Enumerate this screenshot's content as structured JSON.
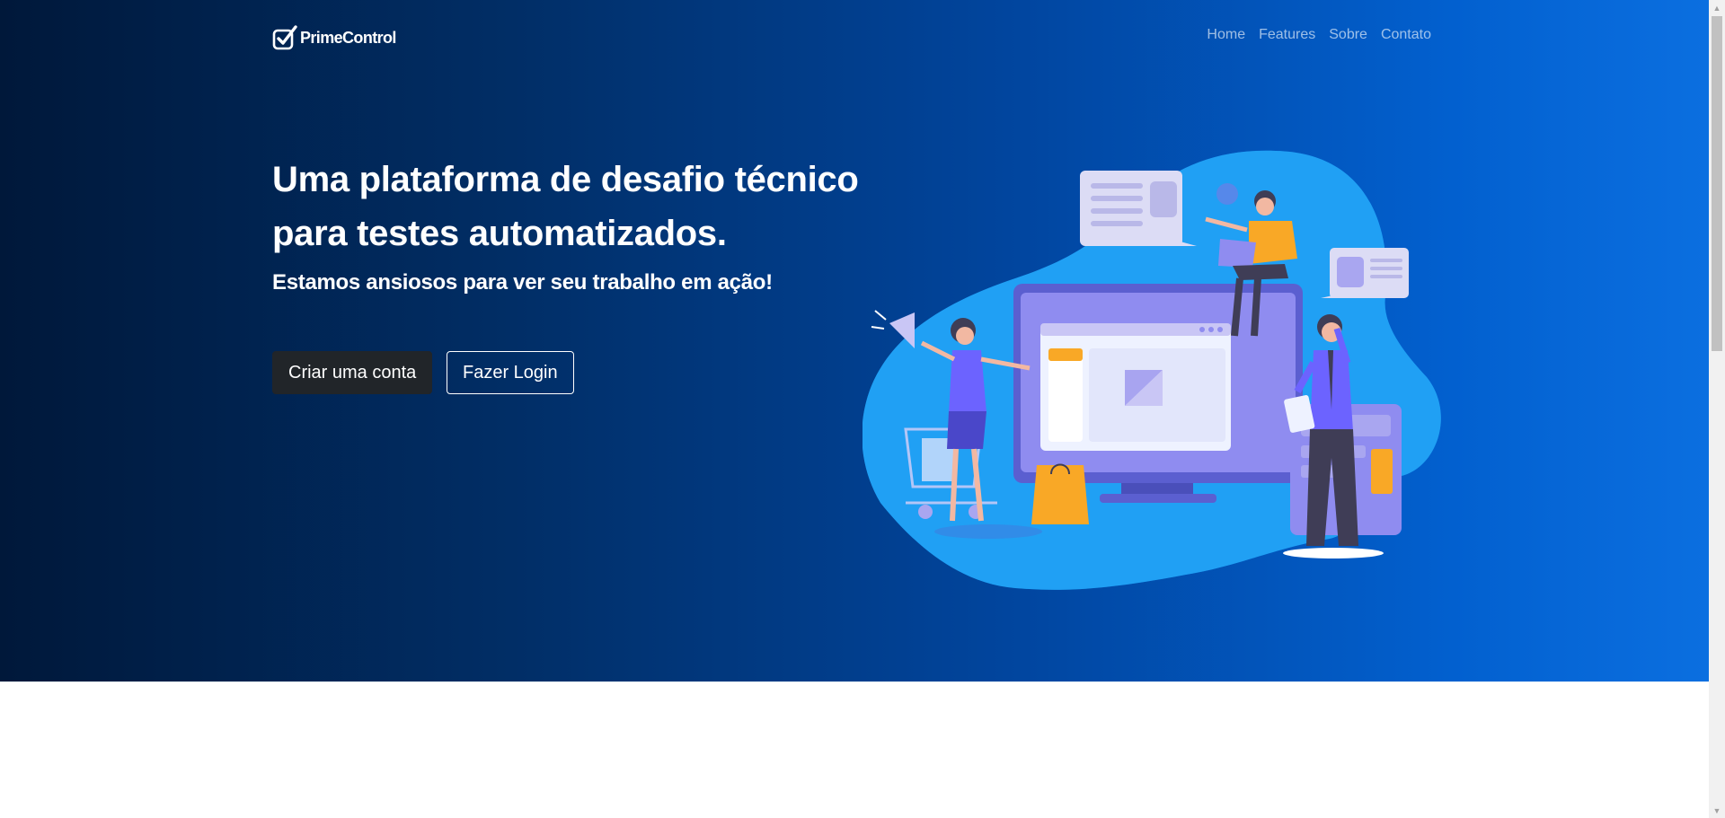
{
  "brand": {
    "name": "PrimeControl",
    "icon": "checkbox-logo-icon"
  },
  "nav": {
    "links": [
      "Home",
      "Features",
      "Sobre",
      "Contato"
    ]
  },
  "hero": {
    "headline": "Uma plataforma de desafio técnico para testes automatizados.",
    "subheadline": "Estamos ansiosos para ver seu trabalho em ação!",
    "primary_button": "Criar uma conta",
    "secondary_button": "Fazer Login",
    "illustration": "team-with-computer-illustration"
  },
  "colors": {
    "hero_gradient_start": "#00183a",
    "hero_gradient_end": "#0b6fe0",
    "primary_button_bg": "#212529",
    "illustration_blob": "#1aa6f5",
    "accent_yellow": "#f9a826",
    "accent_purple": "#6c63ff"
  }
}
